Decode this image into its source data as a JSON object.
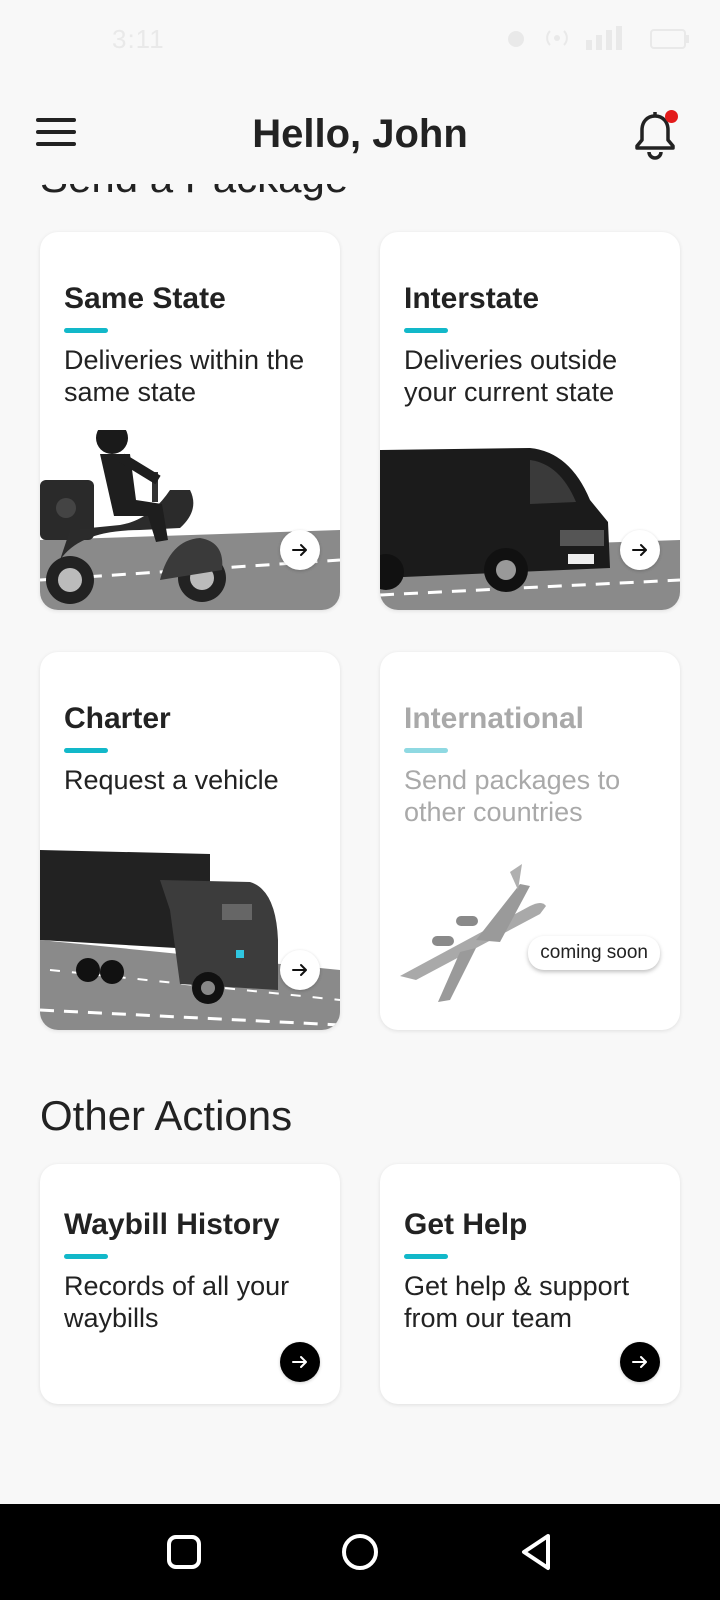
{
  "status_bar": {
    "time": "3:11"
  },
  "header": {
    "title": "Hello, John"
  },
  "send_section": {
    "title": "Send a Package"
  },
  "cards": {
    "same_state": {
      "title": "Same State",
      "desc": "Deliveries within the same state"
    },
    "interstate": {
      "title": "Interstate",
      "desc": "Deliveries outside your current state"
    },
    "charter": {
      "title": "Charter",
      "desc": "Request a vehicle"
    },
    "international": {
      "title": "International",
      "desc": "Send packages to other countries",
      "badge": "coming soon"
    }
  },
  "other_section": {
    "title": "Other Actions"
  },
  "actions": {
    "waybill": {
      "title": "Waybill History",
      "desc": "Records of all your waybills"
    },
    "help": {
      "title": "Get Help",
      "desc": "Get help & support from our team"
    }
  },
  "colors": {
    "accent": "#12b8c9",
    "notification_dot": "#e31b1b"
  }
}
